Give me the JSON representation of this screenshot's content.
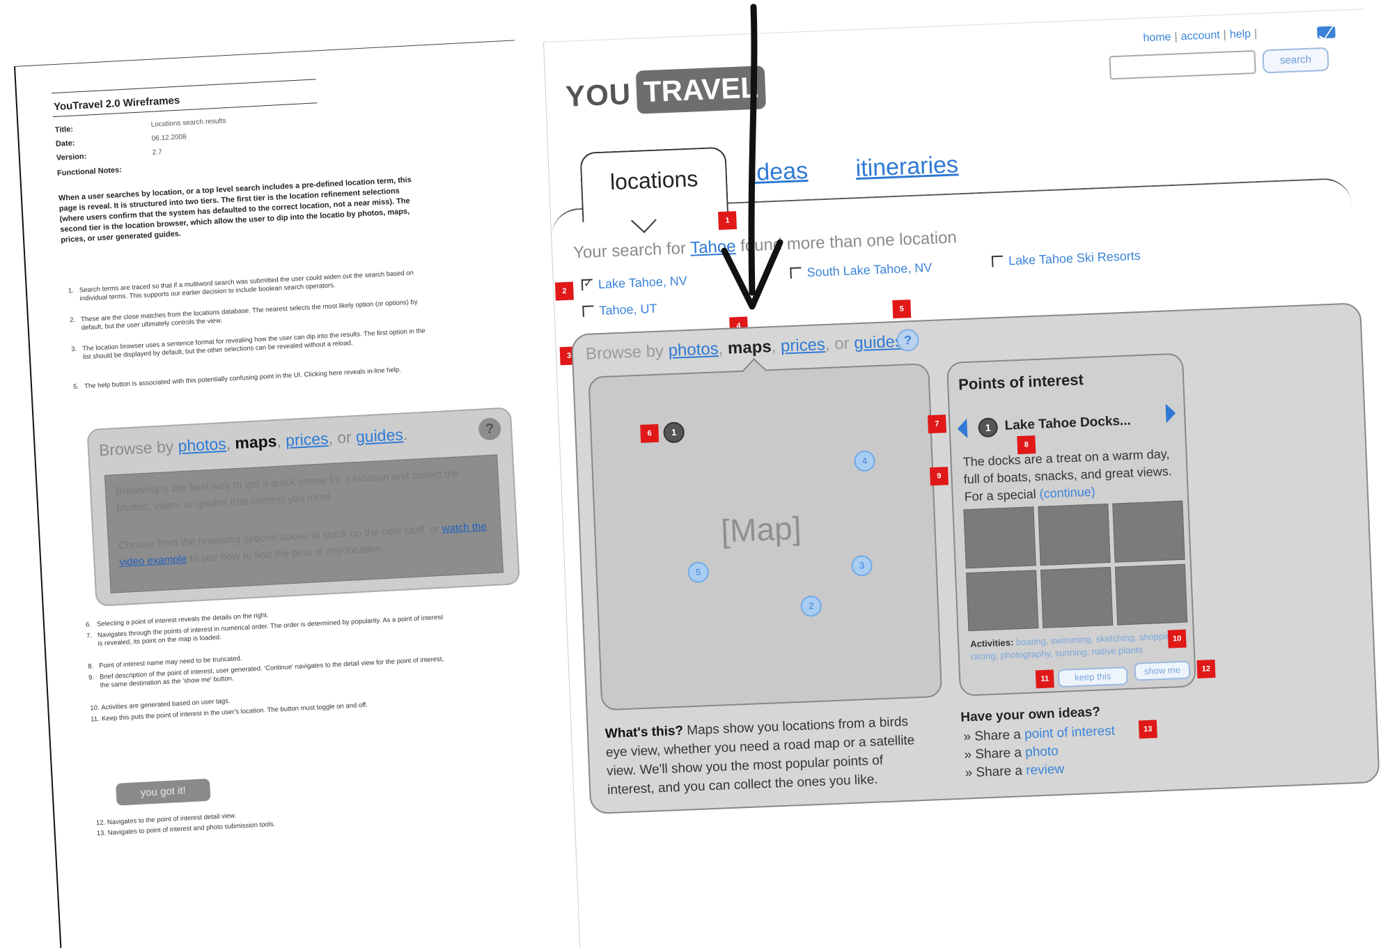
{
  "spec": {
    "title": "YouTravel 2.0 Wireframes",
    "meta": [
      {
        "key": "Title:",
        "value": "Locations search results"
      },
      {
        "key": "Date:",
        "value": "06.12.2008"
      },
      {
        "key": "Version:",
        "value": "2.7"
      },
      {
        "key": "Functional Notes:",
        "value": ""
      }
    ],
    "intro": "When a user searches by location, or a top level search includes a pre-defined location term, this page is reveal. It is structured into two tiers. The first tier is the location refinement selections (where users confirm that the system has defaulted to the correct location, not a near miss). The second tier is the location browser, which allow the user to dip into the locatio by photos, maps, prices, or user generated guides.",
    "notes_top": [
      {
        "num": "1.",
        "text": "Search terms are traced so that if a multiword search was submitted the user could widen out the search based on individual terms. This supports our earlier decision to include boolean search operators."
      },
      {
        "num": "2.",
        "text": "These are the close matches from the locations database. The nearest selects the most likely option (or options) by default, but the user ultimately controls the view."
      },
      {
        "num": "3.",
        "text": "The location browser uses a sentence format for revealing how the user can dip into the results. The first option in the list should be displayed by default, but the other selections can be revealed without a reload."
      },
      {
        "num": "5.",
        "text": "The help button is associated with this potentially confusing point in the UI. Clicking here reveals in-line help."
      }
    ],
    "mini_panel": {
      "prefix": "Browse by ",
      "photos": "photos",
      "comma1": ", ",
      "maps": "maps",
      "comma2": ", ",
      "prices": "prices",
      "or": ", or ",
      "guides": "guides",
      "period": ".",
      "help": "?",
      "line1": "Browsing is the best way to get a quick sense for a location and collect the photos, video, or guides that interest you most.",
      "line2_pre": "Choose from the browsing options above to stuck up the next stuff, or ",
      "line2_link": "watch the video example",
      "line2_post": " to see how to find the best of any location."
    },
    "notes_bottom": [
      {
        "num": "6.",
        "text": "Selecting a point of interest reveals the details on the right."
      },
      {
        "num": "7.",
        "text": "Navigates through the points of interest in numerical order. The order is determined by popularity. As a point of interest is revealed, its point on the map is loaded."
      },
      {
        "num": "8.",
        "text": "Point of interest name may need to be truncated."
      },
      {
        "num": "9.",
        "text": "Brief description of the point of interest, user generated. 'Continue' navigates to the detail view for the point of interest, the same destination as the 'show me' button."
      },
      {
        "num": "10.",
        "text": "Activities are generated based on user tags."
      },
      {
        "num": "11.",
        "text": "Keep this puts the point of interest in the user's location. The button must toggle on and off."
      }
    ],
    "got_it": "you got it!",
    "notes_end": [
      {
        "num": "12.",
        "text": "Navigates to the point of interest detail view."
      },
      {
        "num": "13.",
        "text": "Navigates to point of interest and photo submission tools."
      }
    ]
  },
  "wire": {
    "logo_you": "YOU",
    "logo_travel": "TRAVEL",
    "toplinks": {
      "home": "home",
      "account": "account",
      "help": "help",
      "sep": "|"
    },
    "search": {
      "value": "",
      "button": "search"
    },
    "tabs": {
      "locations": "locations",
      "ideas": "ideas",
      "itineraries": "itineraries"
    },
    "search_msg": {
      "pre": "Your search for ",
      "term": "Tahoe",
      "post": " found more than one location"
    },
    "locations": [
      {
        "label": "Lake Tahoe, NV",
        "checked": true
      },
      {
        "label": "South Lake Tahoe, NV",
        "checked": false
      },
      {
        "label": "Lake Tahoe Ski Resorts",
        "checked": false
      },
      {
        "label": "Tahoe, UT",
        "checked": false
      }
    ],
    "browse": {
      "prefix": "Browse by ",
      "photos": "photos",
      "comma1": ", ",
      "maps": "maps",
      "comma2": ", ",
      "prices": "prices",
      "or": ", or ",
      "guides": "guides",
      "period": ".",
      "help": "?"
    },
    "map": {
      "label": "[Map]",
      "pins": [
        {
          "id": "1",
          "active": true
        },
        {
          "id": "4",
          "active": false
        },
        {
          "id": "5",
          "active": false
        },
        {
          "id": "3",
          "active": false
        },
        {
          "id": "2",
          "active": false
        }
      ]
    },
    "poi": {
      "title": "Points of interest",
      "number": "1",
      "name": "Lake Tahoe Docks...",
      "desc_pre": "The docks are a treat on a warm day, full of boats, snacks, and great views. For a special ",
      "desc_link": "(continue)",
      "activities_label": "Activities:",
      "activities": "boating, swimming, sketching, shopping, racing, photography, sunning, native plants",
      "keep": "keep this",
      "show": "show me"
    },
    "whats": {
      "bold": "What's this?",
      "text": " Maps show you locations from a birds eye view, whether you need a road map or a satellite view. We'll show you the most popular points of interest, and you can collect the ones you like."
    },
    "ideas": {
      "heading": "Have your own ideas?",
      "items": [
        {
          "pre": "» Share a ",
          "link": "point of interest"
        },
        {
          "pre": "» Share a ",
          "link": "photo"
        },
        {
          "pre": "» Share a ",
          "link": "review"
        }
      ]
    },
    "markers": [
      "1",
      "2",
      "3",
      "4",
      "5",
      "6",
      "7",
      "8",
      "9",
      "10",
      "11",
      "12",
      "13"
    ]
  },
  "colors": {
    "link": "#2f79d4",
    "marker": "#e01818",
    "panel": "#d6d6d6",
    "dark_thumb": "#7b7b7b"
  }
}
